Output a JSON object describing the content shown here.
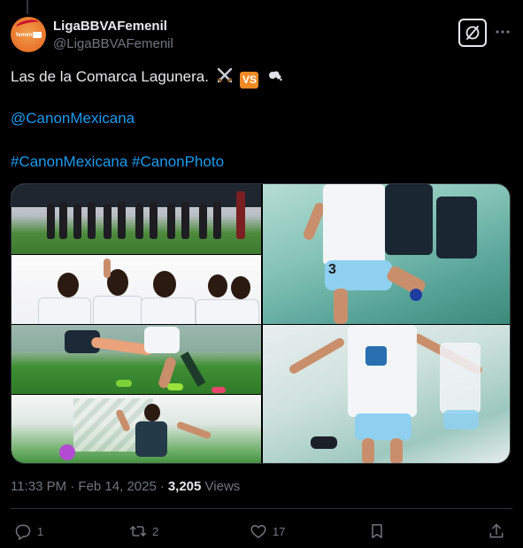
{
  "post": {
    "author": {
      "display_name": "LigaBBVAFemenil",
      "handle": "@LigaBBVAFemenil",
      "avatar_text": "femenil"
    },
    "text": {
      "line1": "Las de la Comarca Lagunera.",
      "vs_badge": "VS",
      "mention": "@CanonMexicana",
      "hashtag1": "#CanonMexicana",
      "hashtag2": "#CanonPhoto"
    },
    "timestamp": "11:33 PM · Feb 14, 2025",
    "views_count": "3,205",
    "views_label": "Views",
    "separator": "·"
  },
  "actions": {
    "replies": "1",
    "reposts": "2",
    "likes": "17"
  },
  "icons": {
    "grok": "grok-icon",
    "more": "more-icon",
    "reply": "reply-icon",
    "repost": "repost-icon",
    "like": "heart-icon",
    "bookmark": "bookmark-icon",
    "share": "share-icon"
  },
  "colors": {
    "background": "#000000",
    "text": "#e7e9ea",
    "muted": "#71767b",
    "link": "#1d9bf0",
    "vs_badge": "#f08a24",
    "avatar": "#e8742c"
  }
}
